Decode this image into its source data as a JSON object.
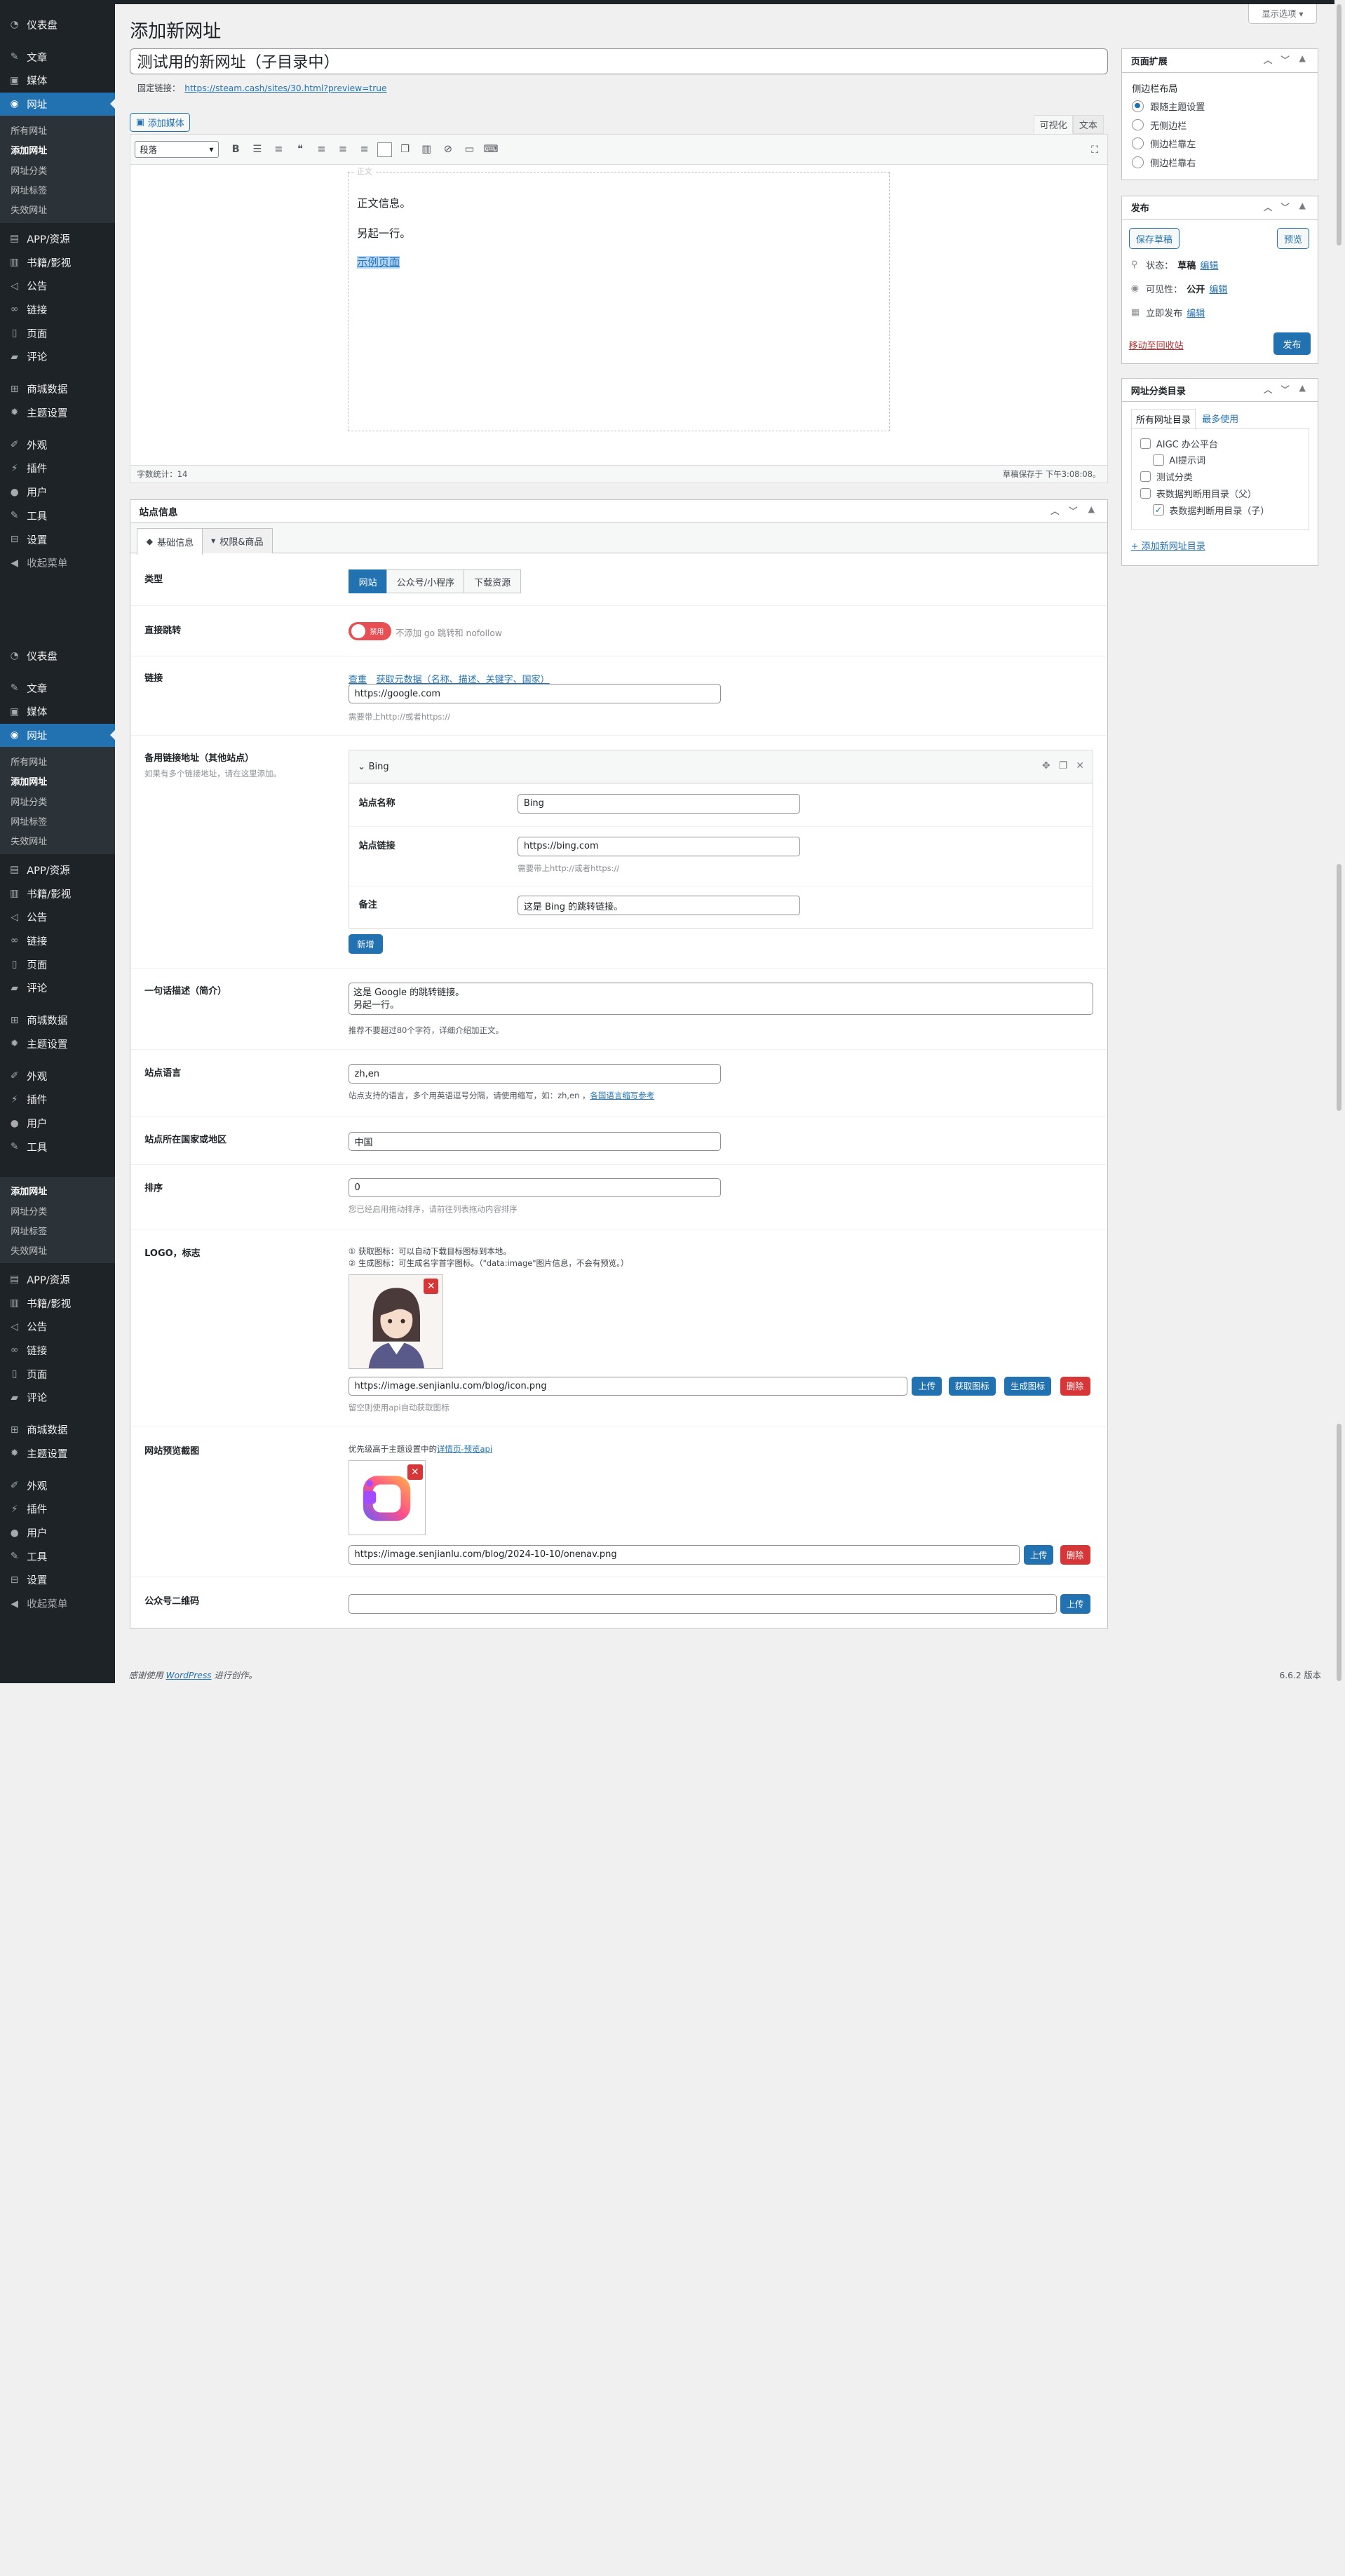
{
  "screen_options": "显示选项 ▾",
  "page_title": "添加新网址",
  "post_title": "测试用的新网址（子目录中）",
  "permalink": {
    "label": "固定链接：",
    "url": "https://steam.cash/sites/30.html?preview=true"
  },
  "add_media": "添加媒体",
  "editor_tabs": {
    "visual": "可视化",
    "text": "文本"
  },
  "format_select": "段落",
  "content": {
    "placeholder": "正文",
    "p1": "正文信息。",
    "p2": "另起一行。",
    "link": "示例页面"
  },
  "status": {
    "word_count": "字数统计：14",
    "draft_saved": "草稿保存于 下午3:08:08。"
  },
  "menu": {
    "dashboard": "仪表盘",
    "posts": "文章",
    "media": "媒体",
    "sites": "网址",
    "sub": [
      "所有网址",
      "添加网址",
      "网址分类",
      "网址标签",
      "失效网址"
    ],
    "app": "APP/资源",
    "books": "书籍/影视",
    "notice": "公告",
    "links": "链接",
    "pages": "页面",
    "comments": "评论",
    "shop": "商城数据",
    "theme": "主题设置",
    "appearance": "外观",
    "plugins": "插件",
    "users": "用户",
    "tools": "工具",
    "settings": "设置",
    "collapse": "收起菜单"
  },
  "site_info": {
    "title": "站点信息",
    "tabs": [
      "基础信息",
      "权限&商品"
    ],
    "type_label": "类型",
    "types": [
      "网站",
      "公众号/小程序",
      "下载资源"
    ],
    "redirect_label": "直接跳转",
    "redirect_toggle": "禁用",
    "redirect_hint": "不添加 go 跳转和 nofollow",
    "link_label": "链接",
    "link_actions": [
      "查重",
      "获取元数据（名称、描述、关键字、国家）"
    ],
    "link_value": "https://google.com",
    "link_help": "需要带上http://或者https://",
    "backup_label": "备用链接地址（其他站点）",
    "backup_sub": "如果有多个链接地址，请在这里添加。",
    "backup_item": {
      "title": "Bing",
      "name_label": "站点名称",
      "name": "Bing",
      "url_label": "站点链接",
      "url": "https://bing.com",
      "url_help": "需要带上http://或者https://",
      "note_label": "备注",
      "note": "这是 Bing 的跳转链接。"
    },
    "add_new": "新增",
    "desc_label": "一句话描述（简介）",
    "desc_value": "这是 Google 的跳转链接。\n另起一行。",
    "desc_help": "推荐不要超过80个字符，详细介绍加正文。",
    "lang_label": "站点语言",
    "lang_value": "zh,en",
    "lang_help": "站点支持的语言，多个用英语逗号分隔，请使用缩写，如：zh,en ，",
    "lang_help_link": "各国语言缩写参考",
    "country_label": "站点所在国家或地区",
    "country_value": "中国",
    "order_label": "排序",
    "order_value": "0",
    "order_help": "您已经启用拖动排序，请前往列表拖动内容排序",
    "logo_label": "LOGO，标志",
    "logo_hint1": "① 获取图标：可以自动下载目标图标到本地。",
    "logo_hint2": "② 生成图标：可生成名字首字图标。（\"data:image\"图片信息，不会有预览。）",
    "logo_url": "https://image.senjianlu.com/blog/icon.png",
    "logo_help": "留空则使用api自动获取图标",
    "logo_btns": [
      "上传",
      "获取图标",
      "生成图标",
      "删除"
    ],
    "preview_label": "网站预览截图",
    "preview_hint": "优先级高于主题设置中的",
    "preview_hint_link": "详情页-预览api",
    "preview_url": "https://image.senjianlu.com/blog/2024-10-10/onenav.png",
    "preview_btns": [
      "上传",
      "删除"
    ],
    "qr_label": "公众号二维码",
    "qr_btn": "上传"
  },
  "side_ext": {
    "title": "页面扩展",
    "layout_label": "侧边栏布局",
    "options": [
      "跟随主题设置",
      "无侧边栏",
      "侧边栏靠左",
      "侧边栏靠右"
    ]
  },
  "publish": {
    "title": "发布",
    "save_draft": "保存草稿",
    "preview": "预览",
    "status_label": "状态：",
    "status_value": "草稿",
    "visibility_label": "可见性：",
    "visibility_value": "公开",
    "schedule": "立即发布",
    "edit": "编辑",
    "trash": "移动至回收站",
    "publish": "发布"
  },
  "categories": {
    "title": "网址分类目录",
    "tabs": [
      "所有网址目录",
      "最多使用"
    ],
    "items": [
      "AIGC 办公平台",
      "AI提示词",
      "测试分类",
      "表数据判断用目录（父）",
      "表数据判断用目录（子）"
    ],
    "add_new": "+ 添加新网址目录"
  },
  "footer": {
    "thanks": "感谢使用 ",
    "wp": "WordPress",
    "rest": " 进行创作。",
    "version": "6.6.2 版本"
  }
}
